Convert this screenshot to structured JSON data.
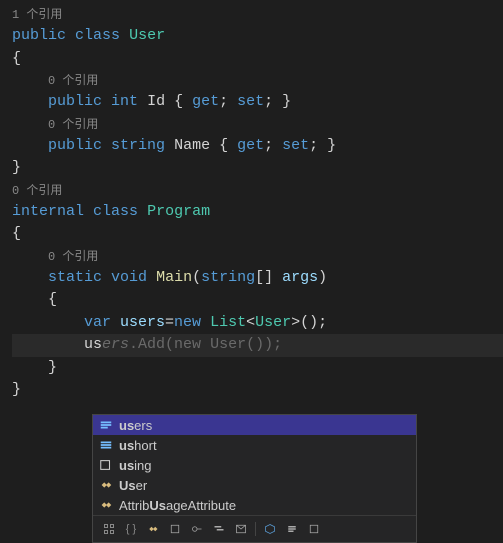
{
  "codelens": {
    "ref1": "1 个引用",
    "ref0a": "0 个引用",
    "ref0b": "0 个引用",
    "ref0c": "0 个引用",
    "ref0d": "0 个引用"
  },
  "code": {
    "l1_public": "public",
    "l1_class": "class",
    "l1_user": "User",
    "brace_open": "{",
    "brace_close": "}",
    "l3_public": "public",
    "l3_int": "int",
    "l3_id": "Id",
    "l3_acc": " { ",
    "l3_get": "get",
    "l3_semi": "; ",
    "l3_set": "set",
    "l3_end": "; }",
    "l5_public": "public",
    "l5_string": "string",
    "l5_name": "Name",
    "l8_internal": "internal",
    "l8_class": "class",
    "l8_program": "Program",
    "l10_static": "static",
    "l10_void": "void",
    "l10_main": "Main",
    "l10_paren": "(",
    "l10_stringtype": "string",
    "l10_arr": "[] ",
    "l10_args": "args",
    "l10_close": ")",
    "l12_var": "var",
    "l12_users": " users",
    "l12_eq": "=",
    "l12_new": "new",
    "l12_list": " List",
    "l12_lt": "<",
    "l12_usertype": "User",
    "l12_gt": ">();",
    "l13_typed": "us",
    "l13_ghost1": "ers",
    "l13_ghost2": ".Add(",
    "l13_ghost_new": "new",
    "l13_ghost3": " User());"
  },
  "intellisense": {
    "items": [
      {
        "icon": "var",
        "pre": "",
        "hl": "us",
        "post": "ers"
      },
      {
        "icon": "kw",
        "pre": "",
        "hl": "us",
        "post": "hort"
      },
      {
        "icon": "kw",
        "pre": "",
        "hl": "us",
        "post": "ing"
      },
      {
        "icon": "cls",
        "pre": "",
        "hl": "Us",
        "post": "er"
      },
      {
        "icon": "cls",
        "pre": "Attrib",
        "hl": "Us",
        "post": "ageAttribute"
      }
    ]
  }
}
